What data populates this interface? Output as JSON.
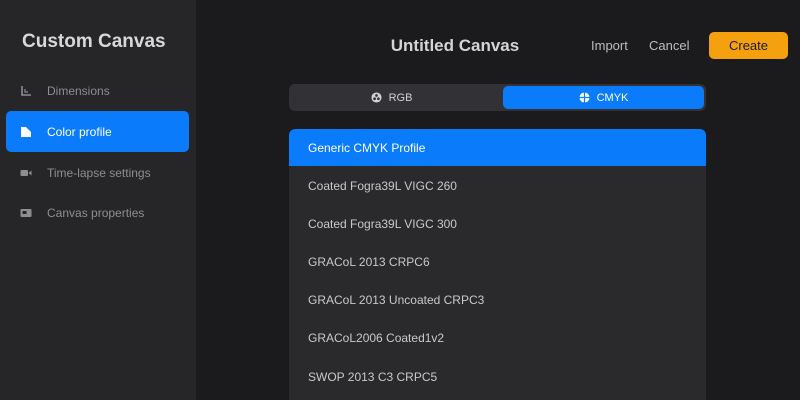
{
  "sidebar": {
    "title": "Custom Canvas",
    "items": [
      {
        "label": "Dimensions",
        "icon": "dimensions-icon"
      },
      {
        "label": "Color profile",
        "icon": "color-profile-icon",
        "active": true
      },
      {
        "label": "Time-lapse settings",
        "icon": "video-camera-icon"
      },
      {
        "label": "Canvas properties",
        "icon": "canvas-properties-icon"
      }
    ]
  },
  "header": {
    "title": "Untitled Canvas",
    "import_label": "Import",
    "cancel_label": "Cancel",
    "create_label": "Create"
  },
  "color_mode": {
    "options": [
      {
        "label": "RGB",
        "icon": "rgb-icon"
      },
      {
        "label": "CMYK",
        "icon": "cmyk-icon",
        "active": true
      }
    ]
  },
  "profiles": {
    "items": [
      {
        "label": "Generic CMYK Profile",
        "selected": true
      },
      {
        "label": "Coated Fogra39L VIGC 260"
      },
      {
        "label": "Coated Fogra39L VIGC 300"
      },
      {
        "label": "GRACoL 2013 CRPC6"
      },
      {
        "label": "GRACoL 2013 Uncoated CRPC3"
      },
      {
        "label": "GRACoL2006 Coated1v2"
      },
      {
        "label": "SWOP 2013 C3 CRPC5"
      }
    ]
  },
  "colors": {
    "accent": "#0a7bfa",
    "create": "#f5a00f",
    "sidebar_bg": "#262628",
    "main_bg": "#1b1b1d"
  }
}
